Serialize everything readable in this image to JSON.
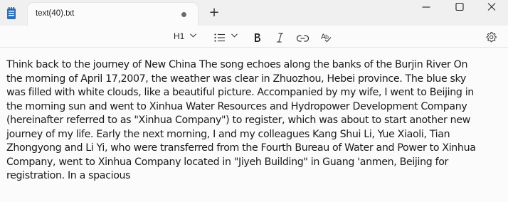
{
  "tab": {
    "title": "text(40).txt",
    "new_tab_symbol": "+"
  },
  "toolbar": {
    "heading_label": "H1",
    "icons": [
      "list-icon",
      "bold-icon",
      "italic-icon",
      "link-icon",
      "spellcheck-icon",
      "settings-icon"
    ]
  },
  "editor": {
    "lines": [
      "Think back to the journey of New China The song echoes along the banks of the Burjin River On",
      "the morning of April 17,2007, the weather was clear in Zhuozhou, Hebei province. The blue sky",
      "was filled with white clouds, like a beautiful picture. Accompanied by my wife, I went to Beijing in",
      "the morning sun and went to Xinhua Water Resources and Hydropower Development Company",
      "(hereinafter referred to as \"Xinhua Company\") to register, which was about to start another new",
      "journey of my life. Early the next morning, I and my colleagues Kang Shui Li, Yue Xiaoli, Tian",
      "Zhongyong and Li Yi, who were transferred from the Fourth Bureau of Water and Power to Xinhua",
      "Company, went to Xinhua Company located in \"Jiyeh Building\" in Guang 'anmen, Beijing for",
      "registration. In a spacious"
    ]
  }
}
